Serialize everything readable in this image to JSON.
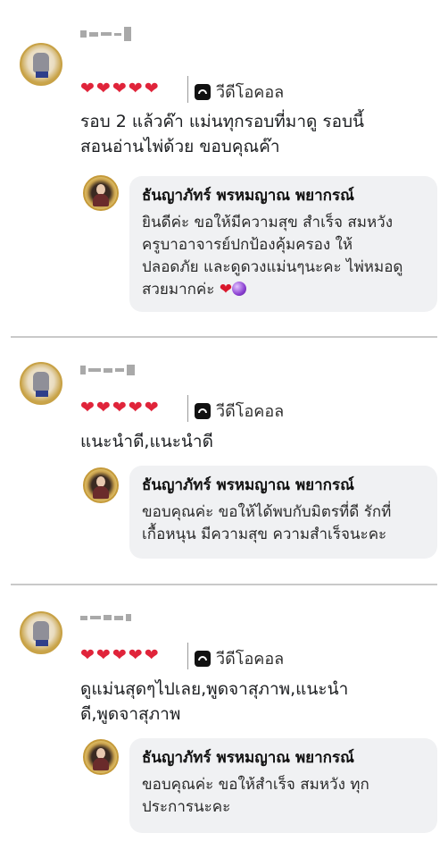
{
  "reviews": [
    {
      "video_label": "วีดีโอคอล",
      "comment_lines": [
        "รอบ 2 แล้วค๊า แม่นทุกรอบที่มาดู รอบนี้",
        "สอนอ่านไพ่ด้วย ขอบคุณค๊า"
      ],
      "reply": {
        "name": "ธันญาภัทร์ พรหมญาณ พยากรณ์",
        "lines": [
          "ยินดีค่ะ ขอให้มีความสุข สำเร็จ สมหวัง",
          "ครูบาอาจารย์ปกป้องคุ้มครอง ให้",
          "ปลอดภัย และดูดวงแม่นๆนะคะ ไพ่หมอดู",
          "สวยมากค่ะ"
        ]
      }
    },
    {
      "video_label": "วีดีโอคอล",
      "comment_lines": [
        "แนะนำดี,แนะนำดี"
      ],
      "reply": {
        "name": "ธันญาภัทร์ พรหมญาณ พยากรณ์",
        "lines": [
          "ขอบคุณค่ะ ขอให้ได้พบกับมิตรที่ดี รักที่",
          "เกื้อหนุน มีความสุข ความสำเร็จนะคะ"
        ]
      }
    },
    {
      "video_label": "วีดีโอคอล",
      "comment_lines": [
        "ดูแม่นสุดๆไปเลย,พูดจาสุภาพ,แนะนำ",
        "ดี,พูดจาสุภาพ"
      ],
      "reply": {
        "name": "ธันญาภัทร์ พรหมญาณ พยากรณ์",
        "lines": [
          "ขอบคุณค่ะ ขอให้สำเร็จ สมหวัง ทุก",
          "ประการนะคะ"
        ]
      }
    }
  ],
  "rating": {
    "stars": 5,
    "max": 5
  },
  "icons": {
    "rating": "heart-icon",
    "call_type": "video-call-icon"
  },
  "colors": {
    "heart": "#e0243a",
    "bubble": "#f0f1f3",
    "separator": "#c9c9c9"
  }
}
